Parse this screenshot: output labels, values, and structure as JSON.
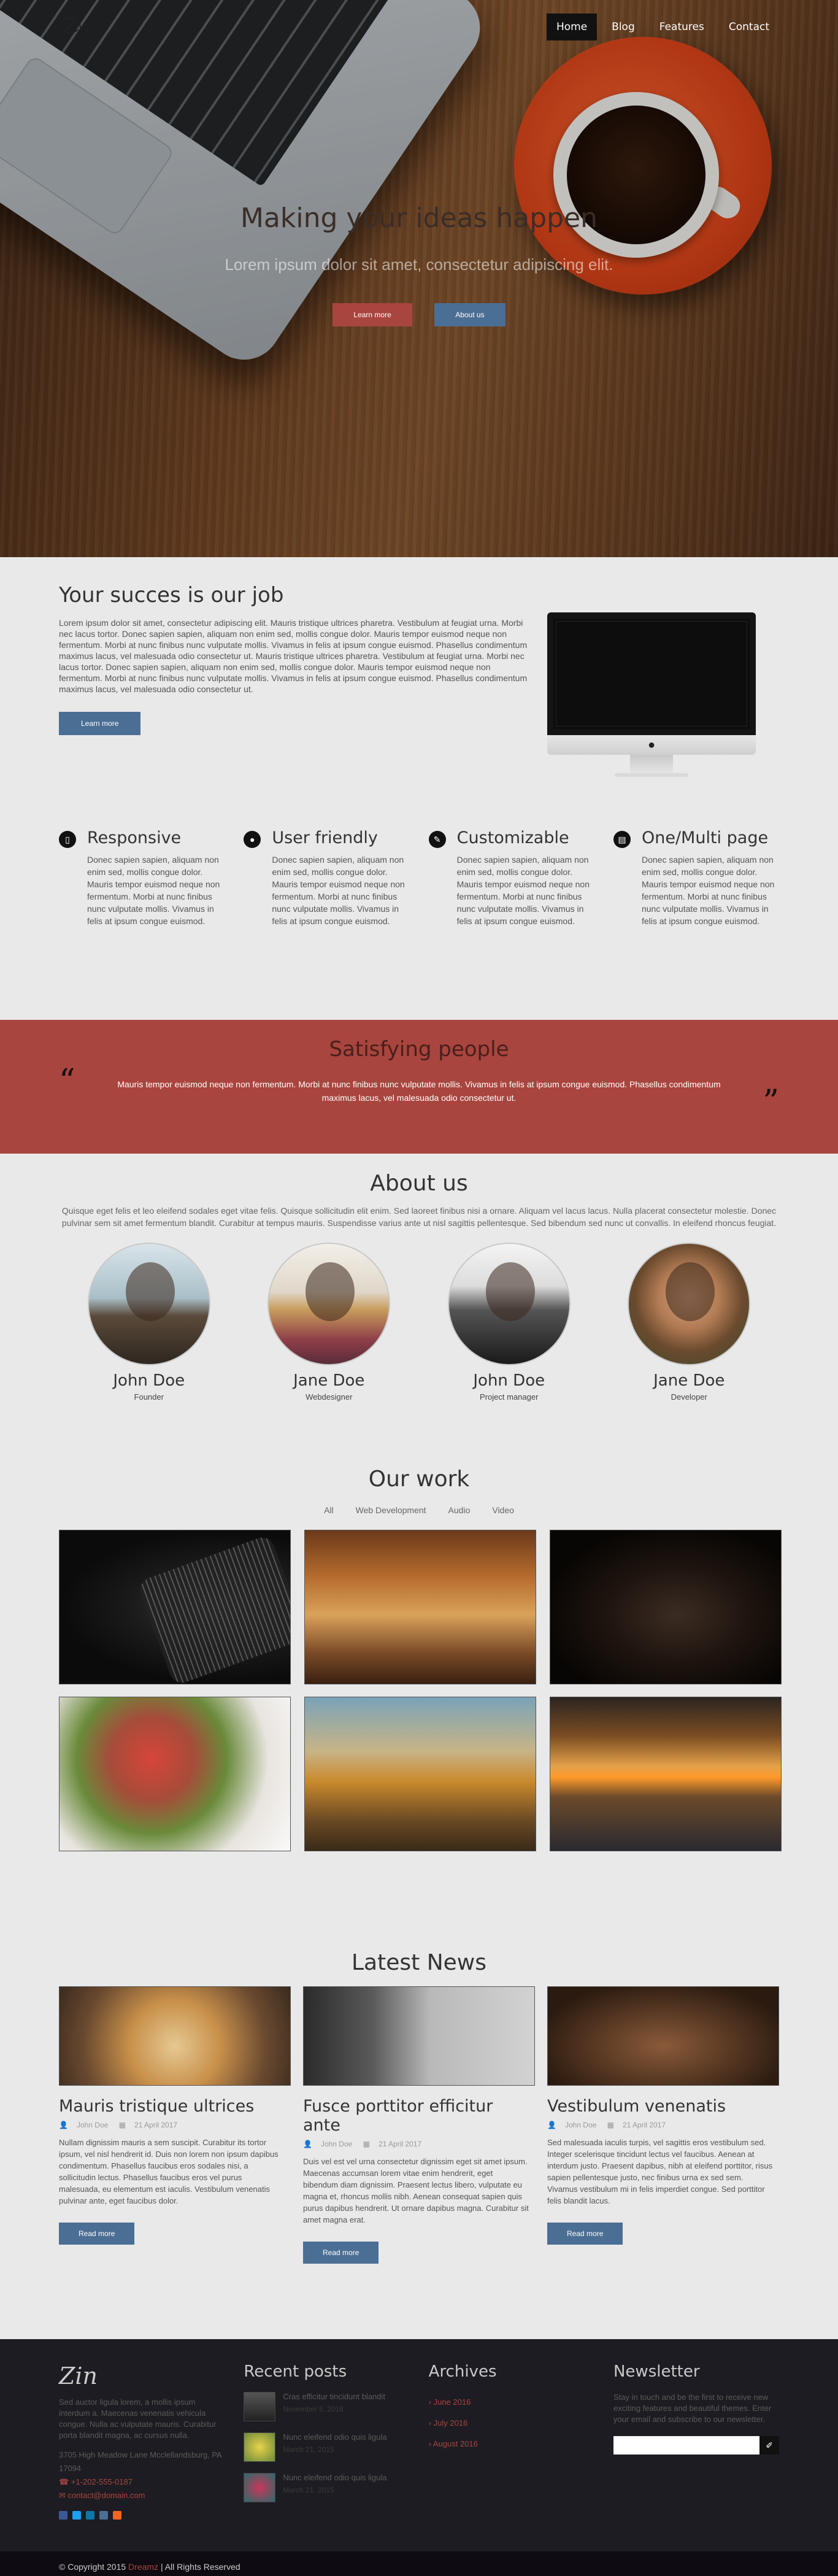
{
  "nav": {
    "items": [
      "Home",
      "Blog",
      "Features",
      "Contact"
    ]
  },
  "hero": {
    "title": "Making your ideas happen",
    "subtitle": "Lorem ipsum dolor sit amet, consectetur adipiscing elit.",
    "btn_learn": "Learn more",
    "btn_about": "About us"
  },
  "success": {
    "title": "Your succes is our job",
    "text": "Lorem ipsum dolor sit amet, consectetur adipiscing elit. Mauris tristique ultrices pharetra. Vestibulum at feugiat urna. Morbi nec lacus tortor. Donec sapien sapien, aliquam non enim sed, mollis congue dolor. Mauris tempor euismod neque non fermentum. Morbi at nunc finibus nunc vulputate mollis. Vivamus in felis at ipsum congue euismod. Phasellus condimentum maximus lacus, vel malesuada odio consectetur ut. Mauris tristique ultrices pharetra. Vestibulum at feugiat urna. Morbi nec lacus tortor. Donec sapien sapien, aliquam non enim sed, mollis congue dolor. Mauris tempor euismod neque non fermentum. Morbi at nunc finibus nunc vulputate mollis. Vivamus in felis at ipsum congue euismod. Phasellus condimentum maximus lacus, vel malesuada odio consectetur ut.",
    "button": "Learn more"
  },
  "features": [
    {
      "icon": "mobile-icon",
      "glyph": "▯",
      "title": "Responsive",
      "text": "Donec sapien sapien, aliquam non enim sed, mollis congue dolor. Mauris tempor euismod neque non fermentum. Morbi at nunc finibus nunc vulputate mollis. Vivamus in felis at ipsum congue euismod."
    },
    {
      "icon": "user-icon",
      "glyph": "●",
      "title": "User friendly",
      "text": "Donec sapien sapien, aliquam non enim sed, mollis congue dolor. Mauris tempor euismod neque non fermentum. Morbi at nunc finibus nunc vulputate mollis. Vivamus in felis at ipsum congue euismod."
    },
    {
      "icon": "pencil-icon",
      "glyph": "✎",
      "title": "Customizable",
      "text": "Donec sapien sapien, aliquam non enim sed, mollis congue dolor. Mauris tempor euismod neque non fermentum. Morbi at nunc finibus nunc vulputate mollis. Vivamus in felis at ipsum congue euismod."
    },
    {
      "icon": "page-icon",
      "glyph": "▤",
      "title": "One/Multi page",
      "text": "Donec sapien sapien, aliquam non enim sed, mollis congue dolor. Mauris tempor euismod neque non fermentum. Morbi at nunc finibus nunc vulputate mollis. Vivamus in felis at ipsum congue euismod."
    }
  ],
  "satisfying": {
    "title": "Satisfying people",
    "quote": "Mauris tempor euismod neque non fermentum. Morbi at nunc finibus nunc vulputate mollis. Vivamus in felis at ipsum congue euismod. Phasellus condimentum maximus lacus, vel malesuada odio consectetur ut.",
    "open_quote": "“",
    "close_quote": "”"
  },
  "about": {
    "title": "About us",
    "intro": "Quisque eget felis et leo eleifend sodales eget vitae felis. Quisque sollicitudin elit enim. Sed laoreet finibus nisi a ornare. Aliquam vel lacus lacus. Nulla placerat consectetur molestie. Donec pulvinar sem sit amet fermentum blandit. Curabitur at tempus mauris. Suspendisse varius ante ut nisl sagittis pellentesque. Sed bibendum sed nunc ut convallis. In eleifend rhoncus feugiat.",
    "team": [
      {
        "name": "John Doe",
        "role": "Founder"
      },
      {
        "name": "Jane Doe",
        "role": "Webdesigner"
      },
      {
        "name": "John Doe",
        "role": "Project manager"
      },
      {
        "name": "Jane Doe",
        "role": "Developer"
      }
    ]
  },
  "work": {
    "title": "Our work",
    "filters": [
      "All",
      "Web Development",
      "Audio",
      "Video"
    ]
  },
  "news": {
    "title": "Latest News",
    "posts": [
      {
        "title": "Mauris tristique ultrices",
        "author": "John Doe",
        "date": "21 April 2017",
        "text": "Nullam dignissim mauris a sem suscipit. Curabitur its tortor ipsum, vel nisl hendrerit id. Duis non lorem non ipsum dapibus condimentum. Phasellus faucibus eros sodales nisi, a sollicitudin lectus. Phasellus faucibus eros vel purus malesuada, eu elementum est iaculis. Vestibulum venenatis pulvinar ante, eget faucibus dolor.",
        "button": "Read more"
      },
      {
        "title": "Fusce porttitor efficitur ante",
        "author": "John Doe",
        "date": "21 April 2017",
        "text": "Duis vel est vel urna consectetur dignissim eget sit amet ipsum. Maecenas accumsan lorem vitae enim hendrerit, eget bibendum diam dignissim. Praesent lectus libero, vulputate eu magna et, rhoncus mollis nibh. Aenean consequat sapien quis purus dapibus hendrerit. Ut ornare dapibus magna. Curabitur sit amet magna erat.",
        "button": "Read more"
      },
      {
        "title": "Vestibulum venenatis",
        "author": "John Doe",
        "date": "21 April 2017",
        "text": "Sed malesuada iaculis turpis, vel sagittis eros vestibulum sed. Integer scelerisque tincidunt lectus vel faucibus. Aenean at interdum justo. Praesent dapibus, nibh at eleifend porttitor, risus sapien pellentesque justo, nec finibus urna ex sed sem. Vivamus vestibulum mi in felis imperdiet congue. Sed porttitor felis blandit lacus.",
        "button": "Read more"
      }
    ]
  },
  "footer": {
    "logo": "Zin",
    "about": "Sed auctor ligula lorem, a mollis ipsum interdum a. Maecenas venenatis vehicula congue. Nulla ac vulputate mauris. Curabitur porta blandit magna, ac cursus nulla.",
    "address": "3705 High Meadow Lane Mcclellandsburg, PA 17094",
    "phone": "+1-202-555-0187",
    "email": "contact@domain.com",
    "recent_title": "Recent posts",
    "recent": [
      {
        "title": "Cras efficitur tincidunt blandit",
        "date": "November 5, 2016"
      },
      {
        "title": "Nunc eleifend odio quis ligula",
        "date": "March 21, 2015"
      },
      {
        "title": "Nunc eleifend odio quis ligula",
        "date": "March 21, 2015"
      }
    ],
    "archives_title": "Archives",
    "archives": [
      "June 2016",
      "July 2016",
      "August 2016"
    ],
    "newsletter_title": "Newsletter",
    "newsletter_text": "Stay in touch and be the first to receive new exciting features and beautiful themes. Enter your email and subscribe to our newsletter.",
    "copyright_pre": "© Copyright 2015",
    "copyright_brand": "Dreamz",
    "copyright_post": "| All Rights Reserved"
  },
  "colors": {
    "accent_red": "#a8453e",
    "accent_blue": "#4b6e94",
    "footer_bg": "#1d1c22"
  }
}
